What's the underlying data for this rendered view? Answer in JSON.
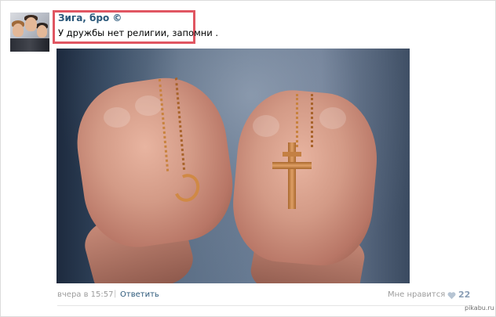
{
  "post": {
    "author": "Зига, бро ©",
    "text": "У дружбы нет религии, запомни .",
    "highlight_color": "#e05662"
  },
  "footer": {
    "date": "вчера в 15:57",
    "separator": "|",
    "reply_label": "Ответить",
    "like_label": "Мне нравится",
    "like_count": "22",
    "like_icon": "heart-icon"
  },
  "watermark": "pikabu.ru",
  "colors": {
    "link": "#2b587a",
    "muted": "#9c9c9c",
    "like_count": "#8a9eb5"
  }
}
